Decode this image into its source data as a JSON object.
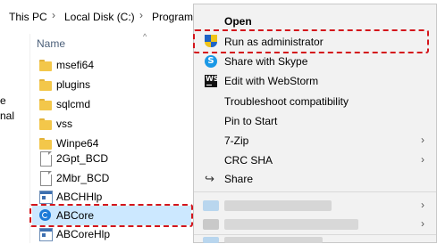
{
  "explorer": {
    "breadcrumb": [
      {
        "label": "This PC"
      },
      {
        "label": "Local Disk (C:)"
      },
      {
        "label": "Program"
      }
    ],
    "breadcrumb_separator": "›",
    "nav_pane_partial": [
      "e",
      "nal"
    ],
    "column_header": "Name",
    "sort_indicator": "^",
    "files": [
      {
        "name": "msefi64",
        "icon": "folder-icon"
      },
      {
        "name": "plugins",
        "icon": "folder-icon"
      },
      {
        "name": "sqlcmd",
        "icon": "folder-icon"
      },
      {
        "name": "vss",
        "icon": "folder-icon"
      },
      {
        "name": "Winpe64",
        "icon": "folder-icon"
      },
      {
        "name": "2Gpt_BCD",
        "icon": "file-icon"
      },
      {
        "name": "2Mbr_BCD",
        "icon": "file-icon"
      },
      {
        "name": "ABCHHlp",
        "icon": "app-icon"
      },
      {
        "name": "ABCore",
        "icon": "abcore-app-icon",
        "selected": true
      },
      {
        "name": "ABCoreHlp",
        "icon": "app-icon"
      }
    ]
  },
  "context_menu": {
    "items": [
      {
        "label": "Open",
        "bold": true
      },
      {
        "label": "Run as administrator",
        "icon": "uac-shield-icon"
      },
      {
        "label": "Share with Skype",
        "icon": "skype-icon"
      },
      {
        "label": "Edit with WebStorm",
        "icon": "webstorm-icon",
        "icon_text": "WS"
      },
      {
        "label": "Troubleshoot compatibility"
      },
      {
        "label": "Pin to Start"
      },
      {
        "label": "7-Zip",
        "submenu": true
      },
      {
        "label": "CRC SHA",
        "submenu": true
      },
      {
        "label": "Share",
        "icon": "share-icon"
      }
    ],
    "submenu_chevron": "›",
    "blurred_items": 3
  },
  "colors": {
    "highlight_dash": "#d4151b",
    "selection": "#cce8ff",
    "menu_background": "#f2f2f2"
  }
}
